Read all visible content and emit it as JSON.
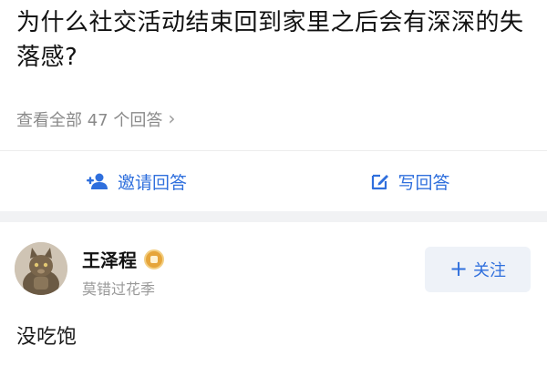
{
  "question": {
    "title": "为什么社交活动结束回到家里之后会有深深的失落感?"
  },
  "view_all": {
    "label": "查看全部 47 个回答",
    "chevron": "›"
  },
  "actions": {
    "invite_label": "邀请回答",
    "write_label": "写回答",
    "invite_icon": "add-user-icon",
    "write_icon": "edit-icon",
    "accent_color": "#2f6fdd"
  },
  "answer": {
    "author": {
      "name": "王泽程",
      "bio": "莫错过花季",
      "badge_icon": "badge-icon"
    },
    "follow_label": "关注",
    "follow_icon": "+",
    "text": "没吃饱"
  }
}
